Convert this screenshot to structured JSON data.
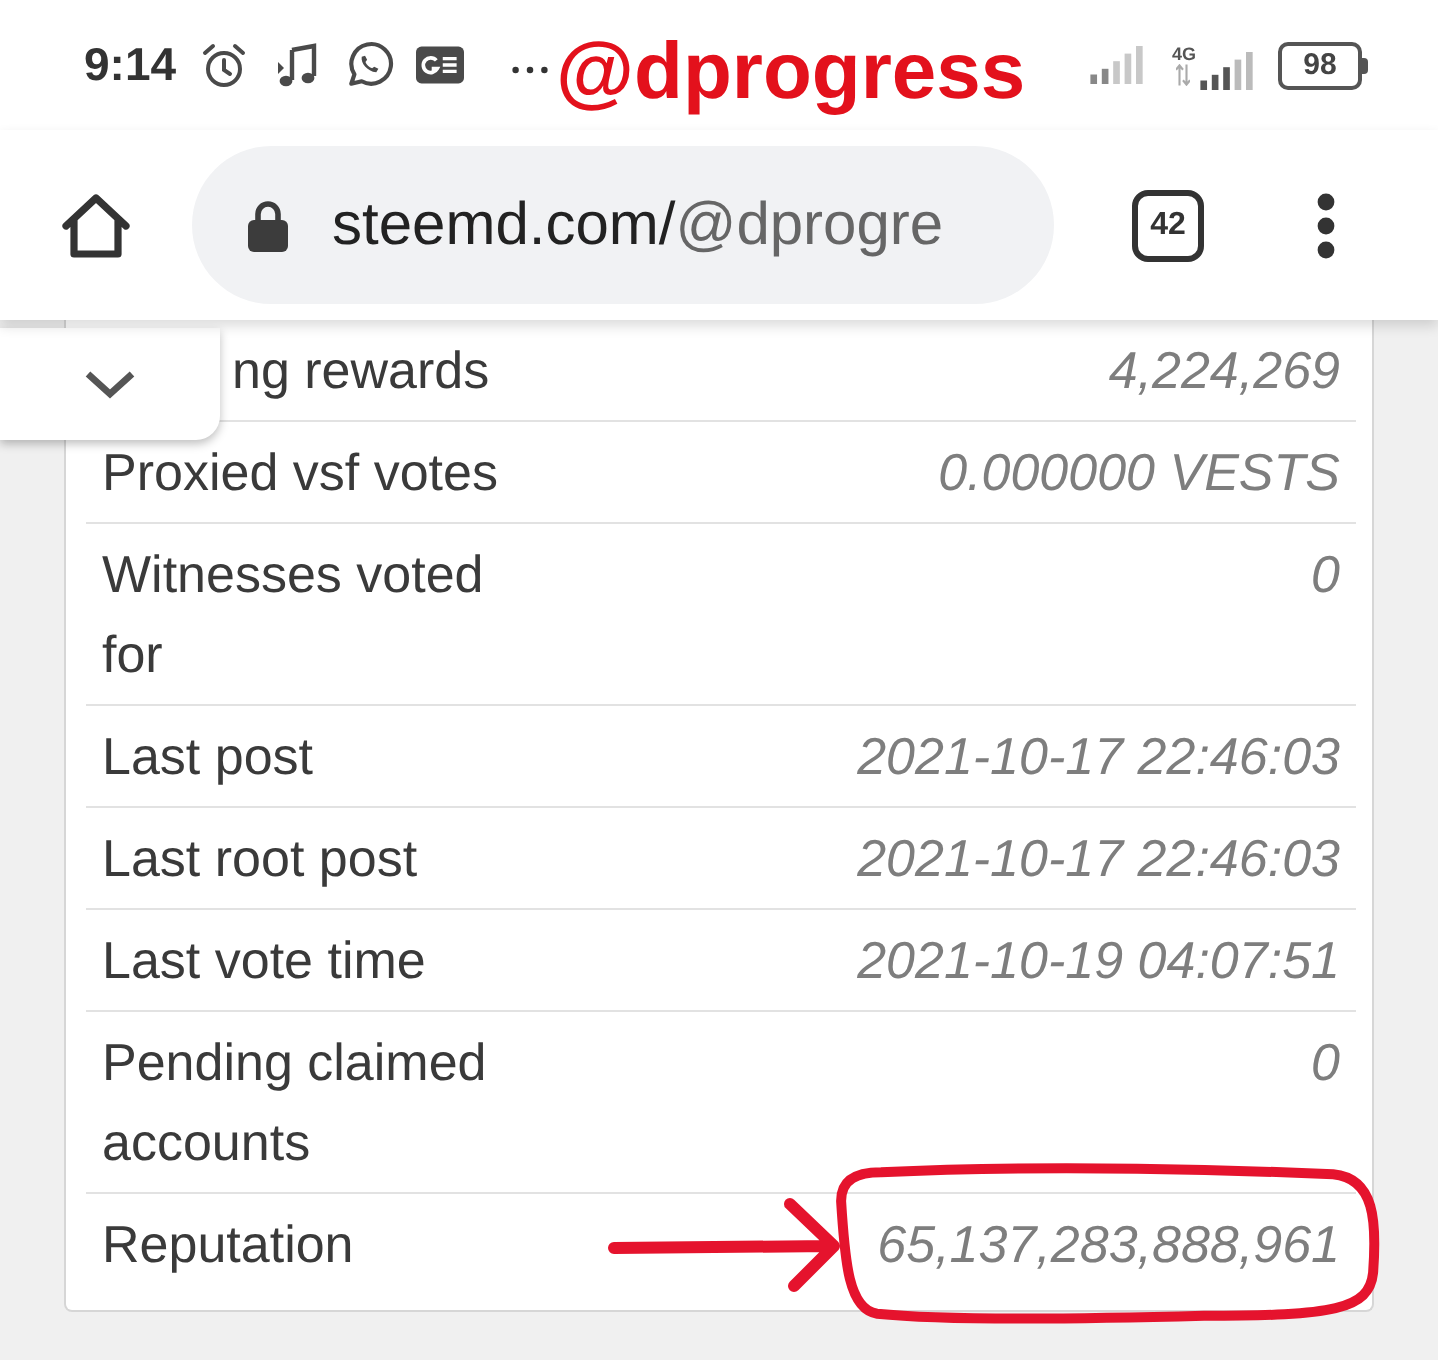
{
  "annotation": {
    "text": "@dprogress"
  },
  "status_bar": {
    "time": "9:14",
    "network": "4G",
    "battery": "98"
  },
  "toolbar": {
    "url_host": "steemd.com/",
    "url_path": "@dprogre",
    "tab_count": "42"
  },
  "table": {
    "rows": [
      {
        "kind": "partial",
        "label": "ng rewards",
        "value": "4,224,269",
        "highlighted": false
      },
      {
        "kind": "full",
        "label": "Proxied vsf votes",
        "value": "0.000000 VESTS",
        "highlighted": false
      },
      {
        "kind": "full",
        "label": "Witnesses voted for",
        "value": "0",
        "highlighted": false
      },
      {
        "kind": "full",
        "label": "Last post",
        "value": "2021-10-17 22:46:03",
        "highlighted": false
      },
      {
        "kind": "full",
        "label": "Last root post",
        "value": "2021-10-17 22:46:03",
        "highlighted": false
      },
      {
        "kind": "full",
        "label": "Last vote time",
        "value": "2021-10-19 04:07:51",
        "highlighted": false
      },
      {
        "kind": "full",
        "label": "Pending claimed accounts",
        "value": "0",
        "highlighted": false
      },
      {
        "kind": "full",
        "label": "Reputation",
        "value": "65,137,283,888,961",
        "highlighted": true
      }
    ]
  }
}
